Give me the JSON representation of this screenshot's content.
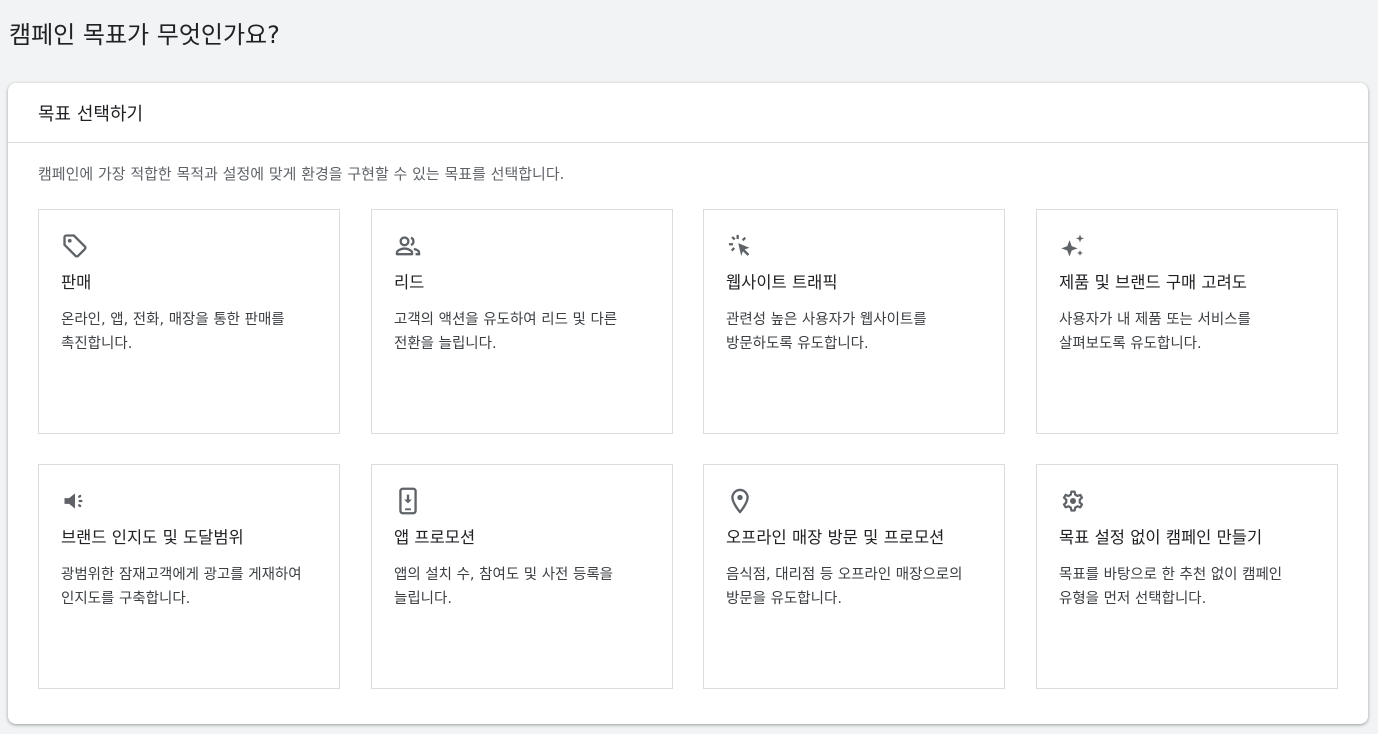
{
  "page": {
    "title": "캠페인 목표가 무엇인가요?"
  },
  "panel": {
    "header": "목표 선택하기",
    "description": "캠페인에 가장 적합한 목적과 설정에 맞게 환경을 구현할 수 있는 목표를 선택합니다."
  },
  "goals": [
    {
      "icon": "tag-icon",
      "title": "판매",
      "description": "온라인, 앱, 전화, 매장을 통한 판매를 촉진합니다."
    },
    {
      "icon": "people-icon",
      "title": "리드",
      "description": "고객의 액션을 유도하여 리드 및 다른 전환을 늘립니다."
    },
    {
      "icon": "cursor-click-icon",
      "title": "웹사이트 트래픽",
      "description": "관련성 높은 사용자가 웹사이트를 방문하도록 유도합니다."
    },
    {
      "icon": "sparkle-icon",
      "title": "제품 및 브랜드 구매 고려도",
      "description": "사용자가 내 제품 또는 서비스를 살펴보도록 유도합니다."
    },
    {
      "icon": "megaphone-icon",
      "title": "브랜드 인지도 및 도달범위",
      "description": "광범위한 잠재고객에게 광고를 게재하여 인지도를 구축합니다."
    },
    {
      "icon": "mobile-download-icon",
      "title": "앱 프로모션",
      "description": "앱의 설치 수, 참여도 및 사전 등록을 늘립니다."
    },
    {
      "icon": "location-pin-icon",
      "title": "오프라인 매장 방문 및 프로모션",
      "description": "음식점, 대리점 등 오프라인 매장으로의 방문을 유도합니다."
    },
    {
      "icon": "gear-icon",
      "title": "목표 설정 없이 캠페인 만들기",
      "description": "목표를 바탕으로 한 추천 없이 캠페인 유형을 먼저 선택합니다."
    }
  ],
  "colors": {
    "background": "#f1f3f4",
    "panel": "#ffffff",
    "border": "#dadce0",
    "icon": "#5f6368",
    "text": "#202124"
  }
}
